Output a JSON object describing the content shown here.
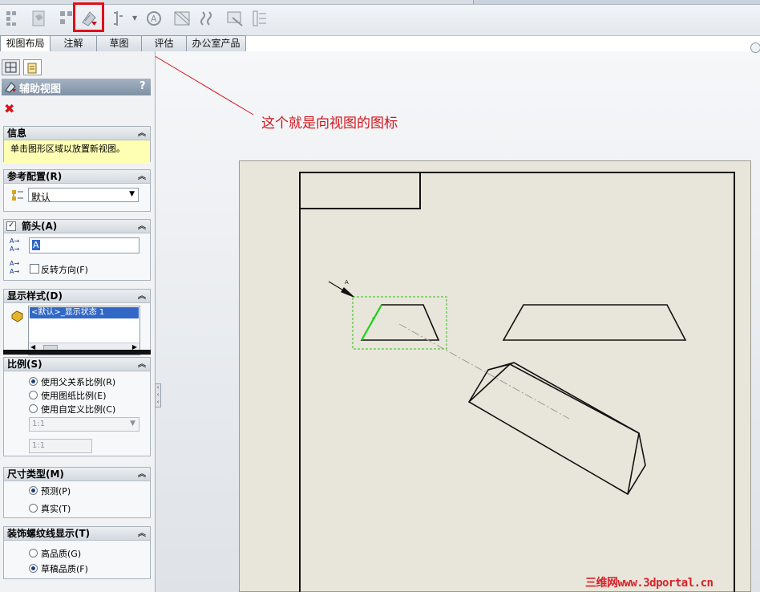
{
  "toolbar": {
    "icons": [
      "model-view-icon",
      "projected-view-icon",
      "standard-3-view-icon",
      "auxiliary-view-icon",
      "section-view-icon",
      "detail-view-icon",
      "broken-out-section-icon",
      "break-icon",
      "crop-view-icon",
      "alternate-position-view-icon"
    ],
    "highlight_color": "#e0101a"
  },
  "tabs": [
    "视图布局",
    "注解",
    "草图",
    "评估",
    "办公室产品"
  ],
  "annotation": {
    "text": "这个就是向视图的图标",
    "color": "#d2141c"
  },
  "panel": {
    "title": "辅助视图",
    "help": "?",
    "info": {
      "header": "信息",
      "message": "单击图形区域以放置新视图。"
    },
    "reference_config": {
      "header": "参考配置(R)",
      "selected": "默认"
    },
    "arrow": {
      "header": "箭头(A)",
      "label_value": "A",
      "reverse_label": "反转方向(F)"
    },
    "display_style": {
      "header": "显示样式(D)",
      "list_item": "<默认>_显示状态 1"
    },
    "scale": {
      "header": "比例(S)",
      "options": [
        "使用父关系比例(R)",
        "使用图纸比例(E)",
        "使用自定义比例(C)"
      ],
      "selected_index": 0,
      "custom_select": "1:1",
      "custom_input": "1:1"
    },
    "dimension_type": {
      "header": "尺寸类型(M)",
      "options": [
        "预测(P)",
        "真实(T)"
      ],
      "selected_index": 0
    },
    "thread_display": {
      "header": "装饰螺纹线显示(T)",
      "options": [
        "高品质(G)",
        "草稿品质(F)"
      ],
      "selected_index": 1
    }
  },
  "drawing": {
    "arrow_letter": "A"
  },
  "watermark": {
    "text": "三维网www.3dportal.cn",
    "color": "#d9202a"
  }
}
